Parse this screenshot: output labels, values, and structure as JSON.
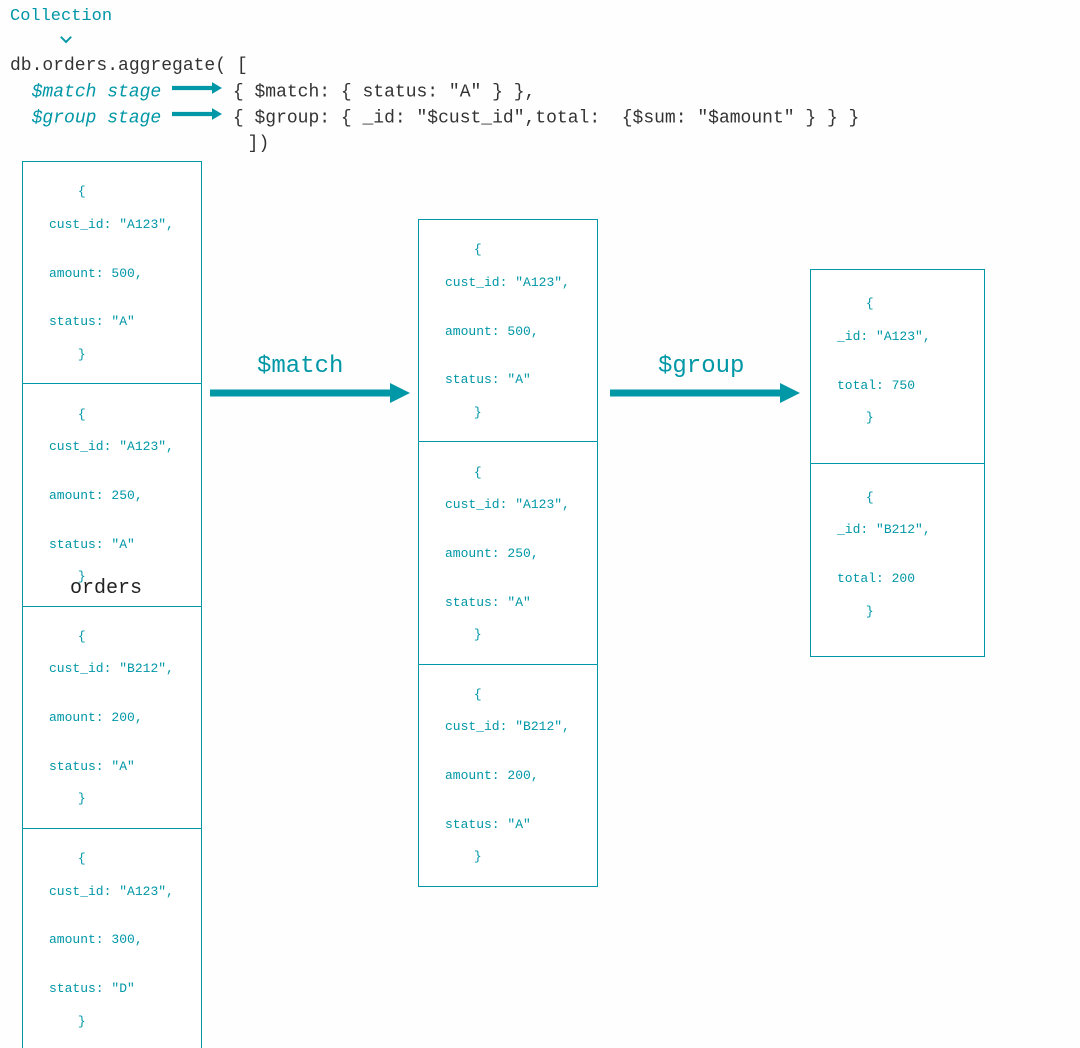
{
  "header": {
    "collection_label": "Collection",
    "db_line": "db.orders.aggregate( [",
    "match_stage_label": "$match stage",
    "match_code": "{ $match: { status: \"A\" } },",
    "group_stage_label": "$group stage",
    "group_code": "{ $group: { _id: \"$cust_id\",total:  {$sum: \"$amount\" } } }",
    "close_line": "])"
  },
  "flow": {
    "match_label": "$match",
    "group_label": "$group",
    "orders_label": "orders"
  },
  "orders_docs": [
    {
      "cust_id": "\"A123\"",
      "amount": "500",
      "status": "\"A\""
    },
    {
      "cust_id": "\"A123\"",
      "amount": "250",
      "status": "\"A\""
    },
    {
      "cust_id": "\"B212\"",
      "amount": "200",
      "status": "\"A\""
    },
    {
      "cust_id": "\"A123\"",
      "amount": "300",
      "status": "\"D\""
    }
  ],
  "matched_docs": [
    {
      "cust_id": "\"A123\"",
      "amount": "500",
      "status": "\"A\""
    },
    {
      "cust_id": "\"A123\"",
      "amount": "250",
      "status": "\"A\""
    },
    {
      "cust_id": "\"B212\"",
      "amount": "200",
      "status": "\"A\""
    }
  ],
  "grouped_docs": [
    {
      "_id": "\"A123\"",
      "total": "750"
    },
    {
      "_id": "\"B212\"",
      "total": "200"
    }
  ],
  "labels": {
    "cust_id": "cust_id:",
    "amount": "amount:",
    "status": "status:",
    "_id": "_id:",
    "total": "total:",
    "open": "{",
    "close": "}",
    "comma": ","
  }
}
